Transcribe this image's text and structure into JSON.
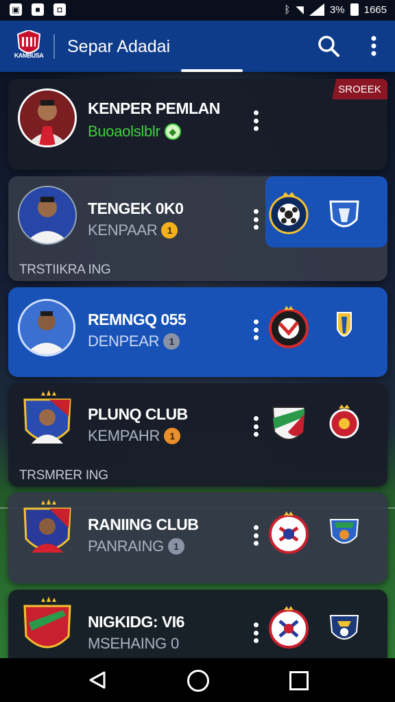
{
  "status_bar": {
    "time": "1665",
    "battery": "3%"
  },
  "app_bar": {
    "logo_text": "KAMBUSA",
    "title": "Separ Adadai"
  },
  "ribbon": {
    "label": "SROEEK"
  },
  "cards": [
    {
      "name": "KENPER PEMLAN",
      "sub": "Buoaolslblr",
      "badge": "◆"
    },
    {
      "name": "TENGEK 0K0",
      "sub": "KENPAAR",
      "badge": "1"
    },
    {
      "name": "REMNGQ 055",
      "sub": "DENPEAR",
      "badge": "1"
    },
    {
      "name": "PLUNQ CLUB",
      "sub": "KEMPAHR",
      "badge": "1"
    },
    {
      "name": "RANIING CLUB",
      "sub": "PANRAING",
      "badge": "1"
    },
    {
      "name": "NIGKIDG: VI6",
      "sub": "MSEHAING",
      "badge": "0"
    }
  ],
  "sections": [
    "TRSTIIKRA ING",
    "TRSMRER ING"
  ],
  "icons": {
    "search": "search-icon",
    "menu": "more-vertical-icon",
    "back": "back-triangle-icon",
    "home": "home-circle-icon",
    "recent": "recents-square-icon"
  },
  "colors": {
    "app_bar": "#0e3b8a",
    "highlight": "#1852b6",
    "ribbon": "#8b1624",
    "accent_green": "#3fcf3f"
  }
}
